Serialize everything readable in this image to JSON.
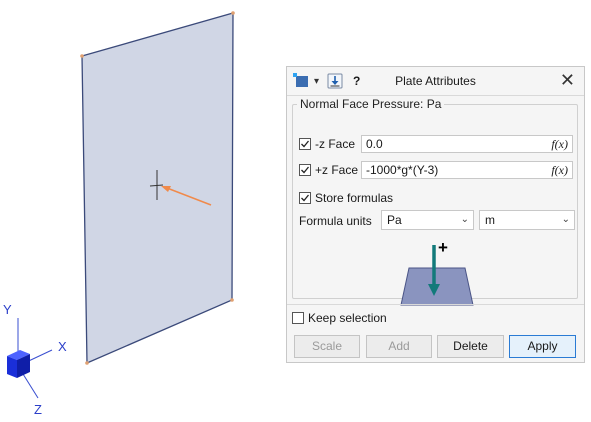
{
  "viewport": {
    "axes": {
      "y_label": "Y",
      "x_label": "X",
      "z_label": "Z"
    }
  },
  "panel": {
    "title": "Plate Attributes",
    "help_label": "?",
    "close_label": "✕",
    "group_label": "Normal Face Pressure: Pa",
    "neg_z": {
      "label": "-z Face",
      "value": "0.0",
      "checked": true,
      "fx": "f(x)"
    },
    "pos_z": {
      "label": "+z Face",
      "value": "-1000*g*(Y-3)",
      "checked": true,
      "fx": "f(x)"
    },
    "store_formulas": {
      "label": "Store formulas",
      "checked": true
    },
    "formula_units": {
      "label": "Formula units",
      "unit1": "Pa",
      "unit2": "m"
    },
    "diagram_sign": "+",
    "keep_selection": {
      "label": "Keep selection",
      "checked": false
    },
    "buttons": {
      "scale": "Scale",
      "add": "Add",
      "delete": "Delete",
      "apply": "Apply"
    }
  },
  "icons": [
    "layers-icon",
    "chevron-down-icon",
    "download-icon",
    "help-icon",
    "close-icon",
    "check-icon",
    "dropdown-arrow-icon",
    "axis-cube-icon"
  ],
  "colors": {
    "plate_fill": "#d0d6e5",
    "plate_edge": "#3b4a7a",
    "arrow": "#f08a4b",
    "accent": "#2a7bd4",
    "cube": "#1a2fd9"
  }
}
